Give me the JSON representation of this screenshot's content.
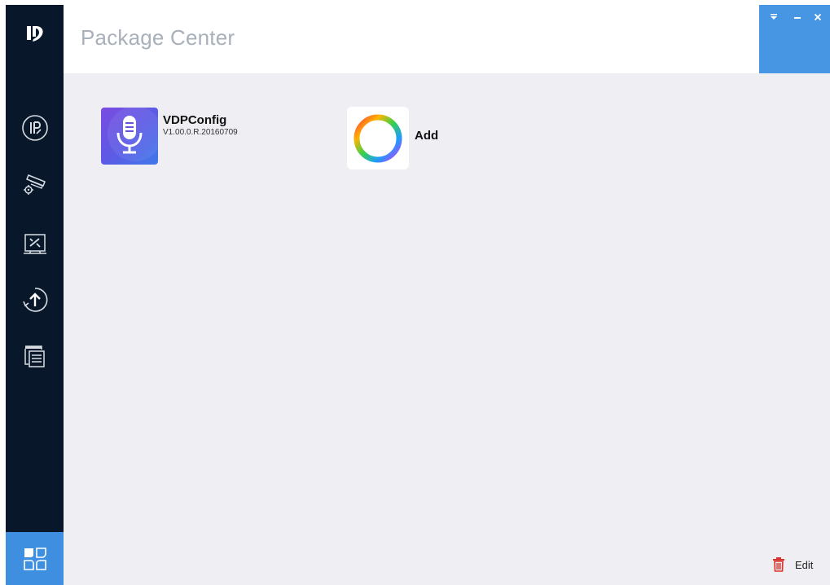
{
  "header": {
    "title": "Package Center"
  },
  "sidebar": {
    "logo_icon": "dp-logo-icon",
    "items": [
      {
        "id": "ip-config",
        "icon": "ip-icon"
      },
      {
        "id": "device-config",
        "icon": "camera-gear-icon"
      },
      {
        "id": "system-config",
        "icon": "tools-icon"
      },
      {
        "id": "upgrade",
        "icon": "upgrade-icon"
      },
      {
        "id": "document",
        "icon": "document-icon"
      }
    ],
    "bottom_item": {
      "id": "package-center",
      "icon": "package-center-icon",
      "active": true
    }
  },
  "window_controls": {
    "menu_icon": "dropdown-icon",
    "minimize_icon": "minimize-icon",
    "close_icon": "close-icon"
  },
  "packages": [
    {
      "name": "VDPConfig",
      "version": "V1.00.0.R.20160709",
      "icon": "microphone-icon"
    },
    {
      "name": "Add",
      "icon": "add-ring-icon"
    }
  ],
  "footer": {
    "edit_label": "Edit",
    "edit_icon": "trash-icon"
  },
  "colors": {
    "sidebar": "#08182a",
    "accent": "#3e8fe0",
    "content_bg": "#eeeef3"
  }
}
